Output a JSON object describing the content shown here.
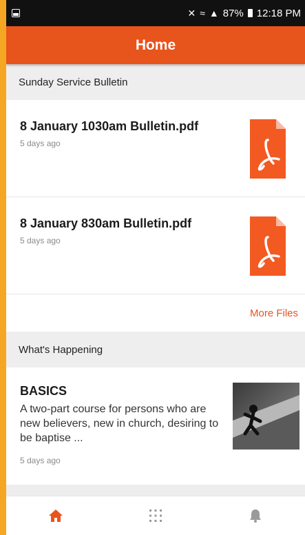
{
  "status_bar": {
    "battery": "87%",
    "time": "12:18 PM"
  },
  "app_bar": {
    "title": "Home"
  },
  "bulletin": {
    "header": "Sunday Service Bulletin",
    "files": [
      {
        "title": "8 January 1030am Bulletin.pdf",
        "subtitle": "5 days ago",
        "icon": "pdf-icon"
      },
      {
        "title": "8 January 830am Bulletin.pdf",
        "subtitle": "5 days ago",
        "icon": "pdf-icon"
      }
    ],
    "more_label": "More Files"
  },
  "happening": {
    "header": "What's Happening",
    "events": [
      {
        "title": "BASICS",
        "description": "A two-part course for persons who are new believers, new in church, desiring to be baptise ...",
        "subtitle": "5 days ago"
      }
    ]
  },
  "bottom_nav": {
    "items": [
      {
        "icon": "home-icon",
        "active": true
      },
      {
        "icon": "grid-icon",
        "active": false
      },
      {
        "icon": "bell-icon",
        "active": false
      }
    ]
  },
  "colors": {
    "accent": "#e7541c",
    "frame": "#f5a623",
    "pdf": "#f25a22"
  }
}
